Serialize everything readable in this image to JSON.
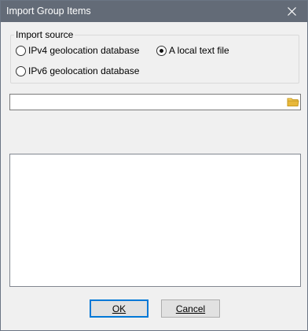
{
  "window": {
    "title": "Import Group Items"
  },
  "source_group": {
    "label": "Import source",
    "options": [
      {
        "label": "IPv4 geolocation database",
        "selected": false
      },
      {
        "label": "A local text file",
        "selected": true
      },
      {
        "label": "IPv6 geolocation database",
        "selected": false
      }
    ]
  },
  "file_path": {
    "value": "",
    "placeholder": ""
  },
  "preview": {
    "text": ""
  },
  "buttons": {
    "ok_label": "OK",
    "cancel_label": "Cancel"
  },
  "icons": {
    "close": "close-icon",
    "browse": "folder-icon"
  },
  "colors": {
    "titlebar": "#636b77",
    "window_bg": "#f0f0f0",
    "default_button_border": "#0078d7",
    "folder_icon": "#e8b83a"
  }
}
